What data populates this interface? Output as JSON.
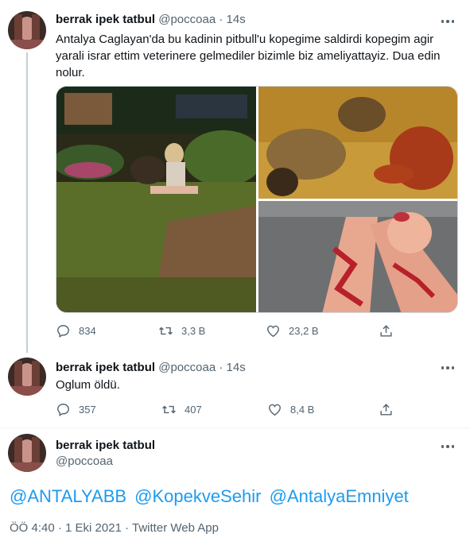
{
  "tweets": [
    {
      "name": "berrak ipek tatbul",
      "handle": "@poccoaa",
      "separator": "·",
      "time": "14s",
      "text": "Antalya Caglayan'da bu kadinin pitbull'u kopegime saldirdi kopegim agir yarali israr ettim veterinere gelmediler bizimle biz ameliyattayiz. Dua edin nolur.",
      "actions": {
        "reply_count": "834",
        "retweet_count": "3,3 B",
        "like_count": "23,2 B"
      }
    },
    {
      "name": "berrak ipek tatbul",
      "handle": "@poccoaa",
      "separator": "·",
      "time": "14s",
      "text": "Oglum öldü.",
      "actions": {
        "reply_count": "357",
        "retweet_count": "407",
        "like_count": "8,4 B"
      }
    }
  ],
  "main_tweet": {
    "name": "berrak ipek tatbul",
    "handle": "@poccoaa",
    "mentions": [
      "@ANTALYABB",
      "@KopekveSehir",
      "@AntalyaEmniyet"
    ],
    "time": "ÖÖ 4:40",
    "separator": "·",
    "date": "1 Eki 2021",
    "source": "Twitter Web App"
  },
  "icons": [
    "more-icon",
    "reply-icon",
    "retweet-icon",
    "like-icon",
    "share-icon"
  ],
  "colors": {
    "link": "#1d9bf0",
    "secondary": "#536471",
    "text": "#0f1419",
    "thread_line": "#c4cfd6"
  }
}
